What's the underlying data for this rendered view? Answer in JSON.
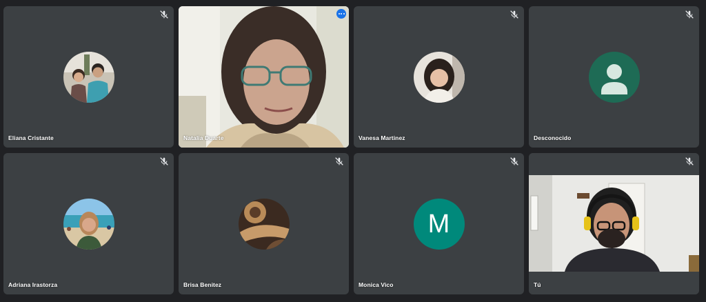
{
  "colors": {
    "background": "#202124",
    "tile": "#3c4043",
    "speaking_outline": "#8ab4f8",
    "avatar_letter_bg": "#00897b",
    "avatar_generic_bg": "#1e6b55"
  },
  "participants": [
    {
      "name": "Eliana Cristante",
      "muted": true,
      "avatar": "photo-couple"
    },
    {
      "name": "Natalia Duarte",
      "muted": false,
      "speaking": true,
      "video": "camera-on"
    },
    {
      "name": "Vanesa Martinez",
      "muted": true,
      "avatar": "photo-girl"
    },
    {
      "name": "Desconocido",
      "muted": true,
      "avatar": "generic-person-icon"
    },
    {
      "name": "Adriana Irastorza",
      "muted": true,
      "avatar": "photo-beach"
    },
    {
      "name": "Brisa Benitez",
      "muted": true,
      "avatar": "photo-guitar"
    },
    {
      "name": "Monica Vico",
      "muted": true,
      "avatar_letter": "M"
    },
    {
      "name": "Tú",
      "muted": true,
      "video": "camera-on"
    }
  ],
  "icons": {
    "mic_off": "mic-off-icon",
    "more": "more-options-icon"
  }
}
